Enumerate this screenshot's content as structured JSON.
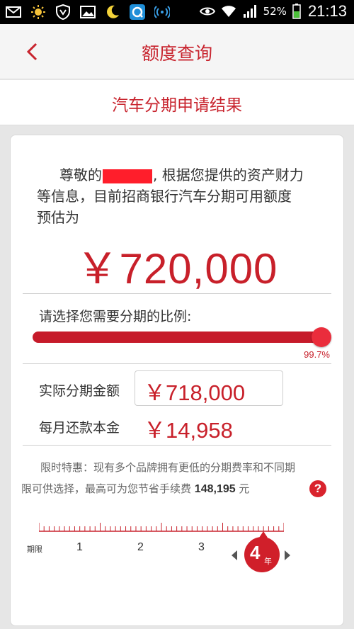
{
  "status_bar": {
    "battery_pct": "52%",
    "time": "21:13",
    "icons": [
      "mail-icon",
      "sun-icon",
      "shield-icon",
      "image-icon",
      "moon-icon",
      "q-app-icon",
      "hotspot-icon",
      "eye-icon",
      "wifi-icon",
      "signal-icon",
      "battery-icon"
    ]
  },
  "header": {
    "title": "额度查询"
  },
  "subheader": {
    "title": "汽车分期申请结果"
  },
  "intro": {
    "prefix": "尊敬的",
    "line1_suffix": ", 根据您提供的资产财力",
    "line2": "等信息，目前招商银行汽车分期可用额度",
    "line3": "预估为"
  },
  "credit_amount": "￥720,000",
  "ratio": {
    "prompt": "请选择您需要分期的比例:",
    "value_label": "99.7%",
    "fraction": 0.997
  },
  "installment": {
    "label": "实际分期金额",
    "value": "￥718,000"
  },
  "monthly": {
    "label": "每月还款本金",
    "value": "￥14,958"
  },
  "promo": {
    "line1": "限时特惠：现有多个品牌拥有更低的分期费率和不同期",
    "line2_prefix": "限可供选择，最高可为您节省手续费",
    "savings": "148,195",
    "unit": "元",
    "help_label": "?"
  },
  "term": {
    "label": "期限",
    "options": [
      "1",
      "2",
      "3"
    ],
    "selected": "4",
    "selected_unit": "年"
  },
  "colors": {
    "accent": "#c8242e",
    "slider": "#c61a2a",
    "redaction": "#ff1e2b"
  }
}
